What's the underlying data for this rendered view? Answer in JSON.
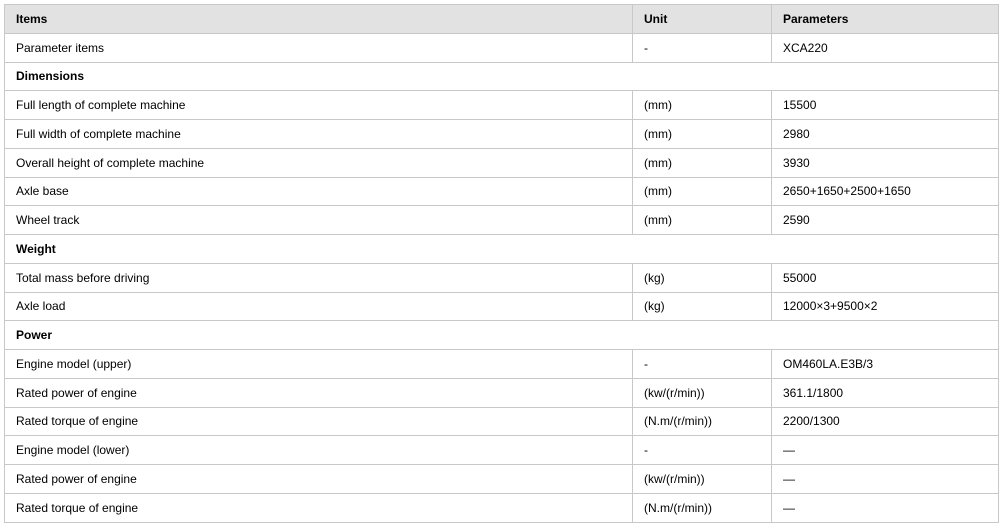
{
  "headers": {
    "items": "Items",
    "unit": "Unit",
    "parameters": "Parameters"
  },
  "rows": [
    {
      "type": "data",
      "item": "Parameter items",
      "unit": "-",
      "value": "XCA220"
    },
    {
      "type": "section",
      "label": "Dimensions"
    },
    {
      "type": "data",
      "item": "Full length of complete machine",
      "unit": "(mm)",
      "value": "15500"
    },
    {
      "type": "data",
      "item": "Full width of complete machine",
      "unit": "(mm)",
      "value": "2980"
    },
    {
      "type": "data",
      "item": "Overall height of complete machine",
      "unit": "(mm)",
      "value": "3930"
    },
    {
      "type": "data",
      "item": "Axle base",
      "unit": "(mm)",
      "value": "2650+1650+2500+1650"
    },
    {
      "type": "data",
      "item": "Wheel track",
      "unit": "(mm)",
      "value": "2590"
    },
    {
      "type": "section",
      "label": "Weight"
    },
    {
      "type": "data",
      "item": "Total mass before driving",
      "unit": "(kg)",
      "value": "55000"
    },
    {
      "type": "data",
      "item": "Axle load",
      "unit": "(kg)",
      "value": "12000×3+9500×2"
    },
    {
      "type": "section",
      "label": "Power"
    },
    {
      "type": "data",
      "item": "Engine model (upper)",
      "unit": "-",
      "value": "OM460LA.E3B/3"
    },
    {
      "type": "data",
      "item": "Rated power of engine",
      "unit": "(kw/(r/min))",
      "value": "361.1/1800"
    },
    {
      "type": "data",
      "item": "Rated torque of engine",
      "unit": "(N.m/(r/min))",
      "value": "2200/1300"
    },
    {
      "type": "data",
      "item": "Engine model (lower)",
      "unit": "-",
      "value": "—"
    },
    {
      "type": "data",
      "item": "Rated power of engine",
      "unit": "(kw/(r/min))",
      "value": "—"
    },
    {
      "type": "data",
      "item": "Rated torque of engine",
      "unit": "(N.m/(r/min))",
      "value": "—"
    }
  ]
}
